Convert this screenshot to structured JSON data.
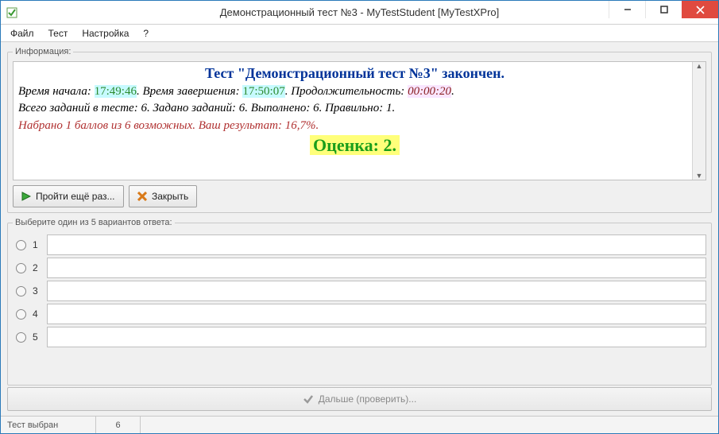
{
  "window": {
    "title": "Демонстрационный тест №3 - MyTestStudent [MyTestXPro]"
  },
  "menu": {
    "file": "Файл",
    "test": "Тест",
    "settings": "Настройка",
    "help": "?"
  },
  "info": {
    "legend": "Информация:",
    "heading": "Тест \"Демонстрационный тест №3\" закончен.",
    "l1_a": "Время начала: ",
    "l1_start": "17:49:46",
    "l1_b": ". Время завершения: ",
    "l1_end": "17:50:07",
    "l1_c": ". Продолжительность: ",
    "l1_dur": "00:00:20",
    "l1_d": ".",
    "l2": "Всего заданий в тесте: 6. Задано заданий: 6. Выполнено: 6. Правильно: 1.",
    "l3_a": "Набрано 1 баллов из 6 возможных. Ваш результат: ",
    "l3_pct": "16,7%",
    "l3_b": ".",
    "grade": "Оценка: 2."
  },
  "buttons": {
    "retry": "Пройти ещё раз...",
    "close": "Закрыть",
    "next": "Дальше (проверить)..."
  },
  "answers": {
    "legend": "Выберите один из 5 вариантов ответа:",
    "n1": "1",
    "n2": "2",
    "n3": "3",
    "n4": "4",
    "n5": "5"
  },
  "status": {
    "selected": "Тест выбран",
    "count": "6"
  }
}
